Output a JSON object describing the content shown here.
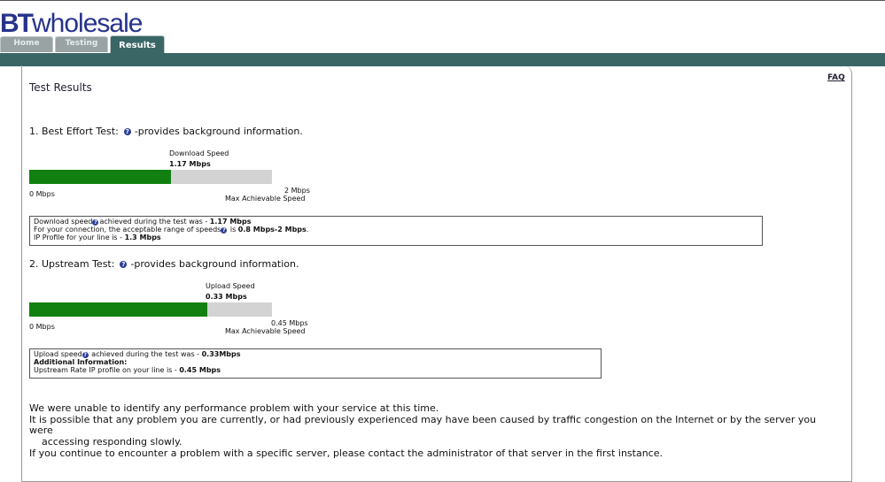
{
  "logo": {
    "bt": "BT",
    "wholesale": "wholesale"
  },
  "tabs": [
    {
      "label": "Home",
      "active": false
    },
    {
      "label": "Testing",
      "active": false
    },
    {
      "label": "Results",
      "active": true
    }
  ],
  "page": {
    "title": "Test Results",
    "faq": "FAQ"
  },
  "best_effort": {
    "heading_prefix": "1. Best Effort Test:",
    "heading_suffix": "-provides background information.",
    "meter_label": "Download  Speed",
    "meter_value": "1.17 Mbps",
    "min_label": "0 Mbps",
    "max_value": "2 Mbps",
    "max_label": "Max Achievable Speed",
    "fill_fraction": 0.585,
    "info_line1_a": "Download speed",
    "info_line1_b": "achieved during the test was - ",
    "info_line1_val": "1.17 Mbps",
    "info_line2_a": "For your connection, the acceptable range of speeds",
    "info_line2_b": " is ",
    "info_line2_val": "0.8 Mbps-2 Mbps",
    "info_line2_end": ".",
    "info_line3_a": "IP Profile for your line is - ",
    "info_line3_val": "1.3 Mbps"
  },
  "upstream": {
    "heading_prefix": "2. Upstream Test:",
    "heading_suffix": "-provides background information.",
    "meter_label": "Upload Speed",
    "meter_value": "0.33 Mbps",
    "min_label": "0 Mbps",
    "max_value": "0.45 Mbps",
    "max_label": "Max Achievable Speed",
    "fill_fraction": 0.733,
    "info_line1_a": "Upload speed",
    "info_line1_b": " achieved during the test was - ",
    "info_line1_val": "0.33Mbps",
    "info_line2": "Additional Information:",
    "info_line3_a": "Upstream Rate IP profile on your line is - ",
    "info_line3_val": "0.45 Mbps"
  },
  "summary": {
    "line1": "We were unable to identify any performance problem with your service at this time.",
    "line2": "It is possible that any problem you are currently, or had previously experienced may have been caused by traffic congestion on the Internet or by the server you were",
    "line3": "accessing responding slowly.",
    "line4": "If you continue to encounter a problem with a specific server, please contact the administrator of that server in the first instance."
  },
  "colors": {
    "brand": "#26338c",
    "nav": "#3a6666",
    "meter_fill": "#118011",
    "meter_track": "#d3d3d3"
  },
  "icons": {
    "help": "question-circle-icon"
  }
}
